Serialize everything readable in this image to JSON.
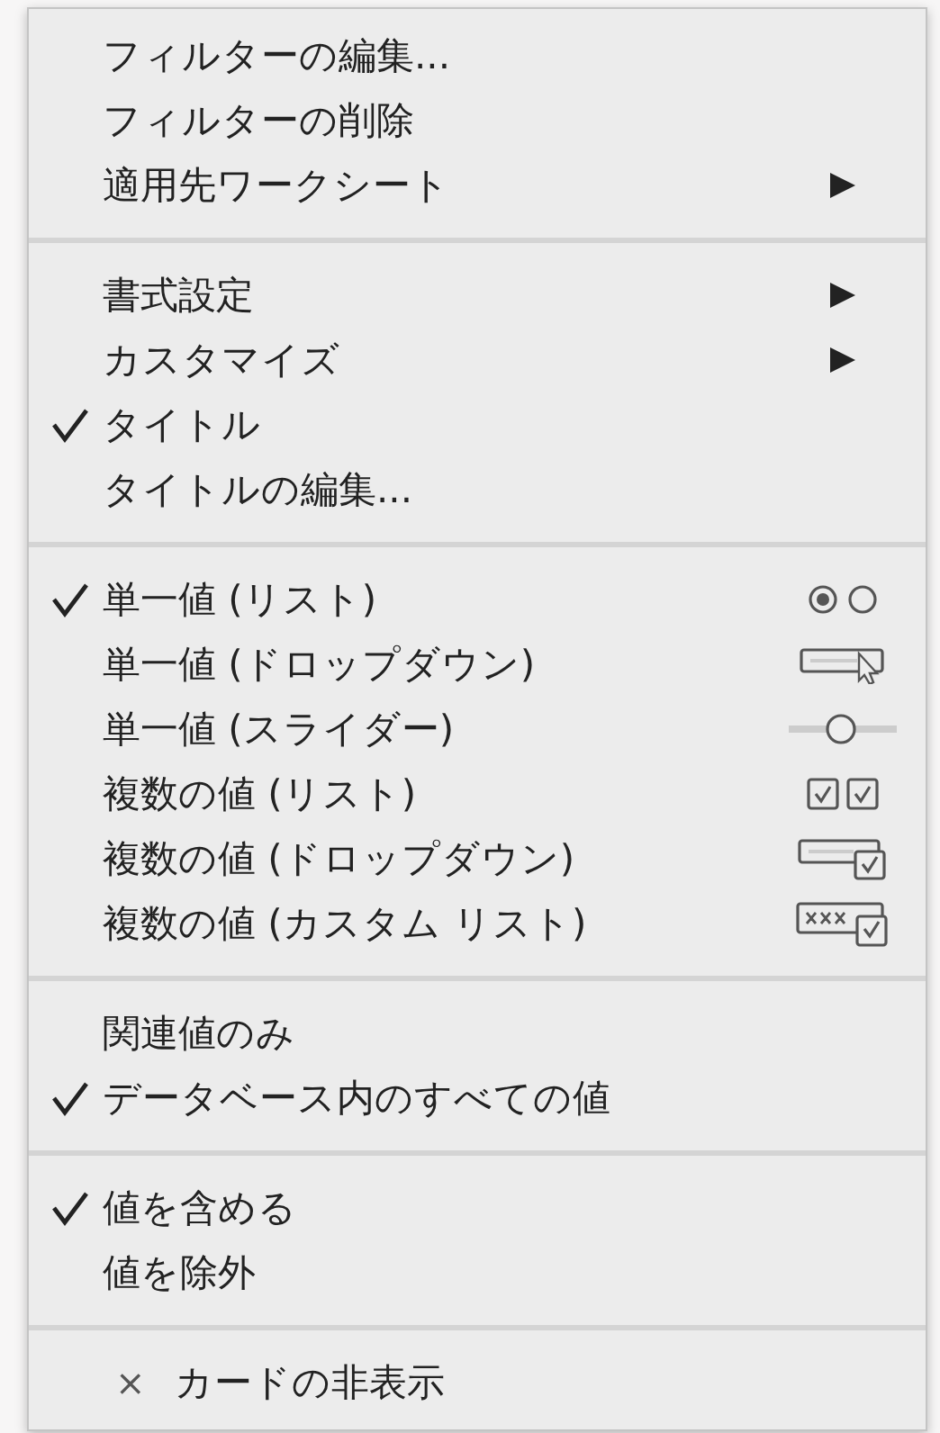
{
  "menu": {
    "sections": [
      {
        "items": [
          {
            "label": "フィルターの編集...",
            "checked": false,
            "submenu": false
          },
          {
            "label": "フィルターの削除",
            "checked": false,
            "submenu": false
          },
          {
            "label": "適用先ワークシート",
            "checked": false,
            "submenu": true
          }
        ]
      },
      {
        "items": [
          {
            "label": "書式設定",
            "checked": false,
            "submenu": true
          },
          {
            "label": "カスタマイズ",
            "checked": false,
            "submenu": true
          },
          {
            "label": "タイトル",
            "checked": true,
            "submenu": false
          },
          {
            "label": "タイトルの編集...",
            "checked": false,
            "submenu": false
          }
        ]
      },
      {
        "items": [
          {
            "label": "単一値 (リスト)",
            "checked": true,
            "submenu": false,
            "kind": "radio-pair"
          },
          {
            "label": "単一値 (ドロップダウン)",
            "checked": false,
            "submenu": false,
            "kind": "dropdown"
          },
          {
            "label": "単一値 (スライダー)",
            "checked": false,
            "submenu": false,
            "kind": "slider"
          },
          {
            "label": "複数の値 (リスト)",
            "checked": false,
            "submenu": false,
            "kind": "checkbox-pair"
          },
          {
            "label": "複数の値 (ドロップダウン)",
            "checked": false,
            "submenu": false,
            "kind": "multi-dropdown"
          },
          {
            "label": "複数の値 (カスタム リスト)",
            "checked": false,
            "submenu": false,
            "kind": "custom-list"
          }
        ]
      },
      {
        "items": [
          {
            "label": "関連値のみ",
            "checked": false,
            "submenu": false
          },
          {
            "label": "データベース内のすべての値",
            "checked": true,
            "submenu": false
          }
        ]
      },
      {
        "items": [
          {
            "label": "値を含める",
            "checked": true,
            "submenu": false
          },
          {
            "label": "値を除外",
            "checked": false,
            "submenu": false
          }
        ]
      },
      {
        "items": [
          {
            "label": "カードの非表示",
            "prefix": "×",
            "checked": false,
            "submenu": false
          }
        ]
      }
    ]
  }
}
